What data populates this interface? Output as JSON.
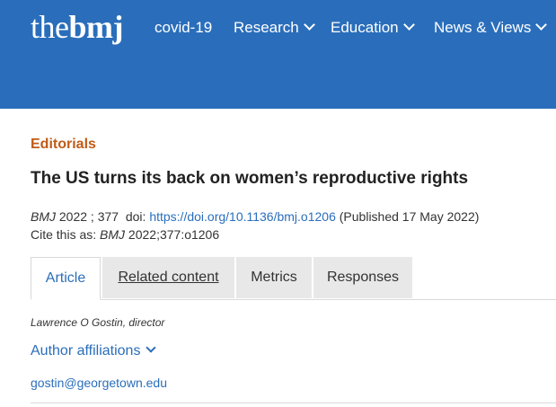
{
  "header": {
    "logo_the": "the",
    "logo_bmj": "bmj",
    "nav": [
      {
        "label": "covid-19",
        "has_dropdown": false
      },
      {
        "label": "Research",
        "has_dropdown": true
      },
      {
        "label": "Education",
        "has_dropdown": true
      },
      {
        "label": "News & Views",
        "has_dropdown": true
      }
    ],
    "background_color": "#2a6ebb"
  },
  "article": {
    "section": "Editorials",
    "title": "The US turns its back on women’s reproductive rights",
    "citation": {
      "journal": "BMJ",
      "year_volume": " 2022 ; 377  doi: ",
      "doi_link": "https://doi.org/10.1136/bmj.o1206",
      "published": " (Published 17 May 2022)",
      "cite_prefix": "Cite this as: ",
      "cite_journal": "BMJ",
      "cite_ref": " 2022;377:o1206"
    },
    "tabs": [
      {
        "label": "Article",
        "active": true
      },
      {
        "label": "Related content",
        "active": false
      },
      {
        "label": "Metrics",
        "active": false
      },
      {
        "label": "Responses",
        "active": false
      }
    ],
    "author": "Lawrence O Gostin, director",
    "affiliations_label": "Author affiliations",
    "email": "gostin@georgetown.edu"
  },
  "colors": {
    "accent": "#2a6ebb",
    "section_label": "#c15b17"
  }
}
